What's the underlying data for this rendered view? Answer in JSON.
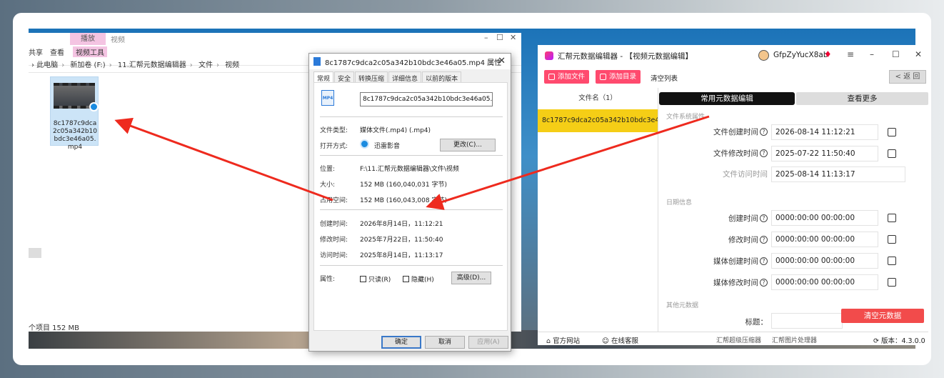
{
  "explorer": {
    "play_tab": "播放",
    "video_tab": "视频",
    "ribbon": [
      "共享",
      "查看",
      "视频工具"
    ],
    "path": [
      "此电脑",
      "新加卷 (F:)",
      "11.汇帮元数据编辑器",
      "文件",
      "视频"
    ],
    "file_name": "8c1787c9dca2c05a342b10bdc3e46a05.mp4",
    "status": "个项目  152 MB"
  },
  "dialog": {
    "title": "8c1787c9dca2c05a342b10bdc3e46a05.mp4 属性",
    "tabs": [
      "常规",
      "安全",
      "转换压缩",
      "详细信息",
      "以前的版本"
    ],
    "icon_label": "MP4",
    "filename": "8c1787c9dca2c05a342b10bdc3e46a05.mp4",
    "type_label": "文件类型:",
    "type_value": "媒体文件(.mp4) (.mp4)",
    "open_label": "打开方式:",
    "open_value": "迅雷影音",
    "change_btn": "更改(C)...",
    "location_label": "位置:",
    "location_value": "F:\\11.汇帮元数据编辑器\\文件\\视频",
    "size_label": "大小:",
    "size_value": "152 MB (160,040,031 字节)",
    "disk_label": "占用空间:",
    "disk_value": "152 MB (160,043,008 字节)",
    "created_label": "创建时间:",
    "created_value": "2026年8月14日，11:12:21",
    "modified_label": "修改时间:",
    "modified_value": "2025年7月22日，11:50:40",
    "accessed_label": "访问时间:",
    "accessed_value": "2025年8月14日，11:13:17",
    "attr_label": "属性:",
    "readonly": "只读(R)",
    "hidden": "隐藏(H)",
    "advanced_btn": "高级(D)...",
    "ok": "确定",
    "cancel": "取消",
    "apply": "应用(A)"
  },
  "editor": {
    "title": "汇帮元数据编辑器 - 【视频元数据编辑】",
    "user": "GfpZyYucX8ab",
    "add_file": "添加文件",
    "add_dir": "添加目录",
    "clear_list": "清空列表",
    "back": "< 返 回",
    "col_header": "文件名（1）",
    "selected_file": "8c1787c9dca2c05a342b10bdc3e46a05.mp4",
    "tab_common": "常用元数据编辑",
    "tab_more": "查看更多",
    "sect_fs": "文件系统属性",
    "fs_created_label": "文件创建时间",
    "fs_created": "2026-08-14 11:12:21",
    "fs_modified_label": "文件修改时间",
    "fs_modified": "2025-07-22 11:50:40",
    "fs_access_label": "文件访问时间",
    "fs_access": "2025-08-14 11:13:17",
    "sect_date": "日期信息",
    "create_label": "创建时间",
    "create_val": "0000:00:00 00:00:00",
    "modify_label": "修改时间",
    "modify_val": "0000:00:00 00:00:00",
    "mcreate_label": "媒体创建时间",
    "mcreate_val": "0000:00:00 00:00:00",
    "mmodify_label": "媒体修改时间",
    "mmodify_val": "0000:00:00 00:00:00",
    "sect_other": "其他元数据",
    "title_label": "标题：",
    "clear_meta": "清空元数据",
    "site": "官方网站",
    "support": "在线客服",
    "compressor": "汇帮超级压缩器",
    "imgproc": "汇帮图片处理器",
    "version": "版本：4.3.0.0"
  },
  "colors": {
    "accent": "#ff4a6e",
    "selected": "#f5ce16",
    "danger": "#f24b4b",
    "arrow": "#ee2a1e"
  }
}
